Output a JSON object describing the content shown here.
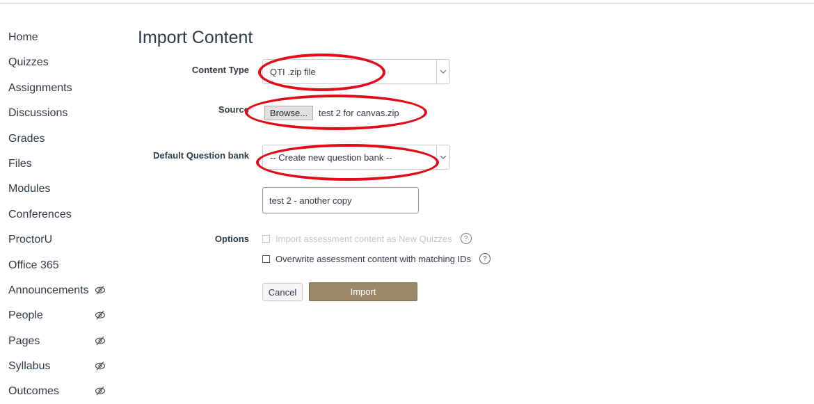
{
  "nav": {
    "items": [
      {
        "label": "Home",
        "hidden": false
      },
      {
        "label": "Quizzes",
        "hidden": false
      },
      {
        "label": "Assignments",
        "hidden": false
      },
      {
        "label": "Discussions",
        "hidden": false
      },
      {
        "label": "Grades",
        "hidden": false
      },
      {
        "label": "Files",
        "hidden": false
      },
      {
        "label": "Modules",
        "hidden": false
      },
      {
        "label": "Conferences",
        "hidden": false
      },
      {
        "label": "ProctorU",
        "hidden": false
      },
      {
        "label": "Office 365",
        "hidden": false
      },
      {
        "label": "Announcements",
        "hidden": true
      },
      {
        "label": "People",
        "hidden": true
      },
      {
        "label": "Pages",
        "hidden": true
      },
      {
        "label": "Syllabus",
        "hidden": true
      },
      {
        "label": "Outcomes",
        "hidden": true
      }
    ],
    "hidden_icon": "eye-slash-icon"
  },
  "page": {
    "title": "Import Content"
  },
  "form": {
    "content_type_label": "Content Type",
    "content_type_value": "QTI .zip file",
    "source_label": "Source",
    "browse_label": "Browse...",
    "source_filename": "test 2 for canvas.zip",
    "question_bank_label": "Default Question bank",
    "question_bank_value": "-- Create new question bank --",
    "new_bank_name": "test 2 - another copy",
    "options_label": "Options",
    "option_new_quizzes": "Import assessment content as New Quizzes",
    "option_overwrite": "Overwrite assessment content with matching IDs",
    "help_glyph": "?",
    "cancel_label": "Cancel",
    "import_label": "Import"
  },
  "colors": {
    "text": "#2d3b45",
    "import_button": "#9c8969",
    "highlight_ring": "#e30b17",
    "disabled_text": "#c5c5c5"
  }
}
